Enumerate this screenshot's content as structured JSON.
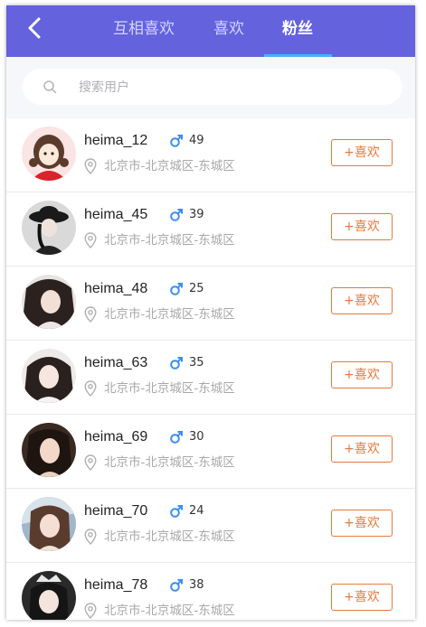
{
  "header": {
    "tabs": [
      {
        "label": "互相喜欢",
        "active": false
      },
      {
        "label": "喜欢",
        "active": false
      },
      {
        "label": "粉丝",
        "active": true
      }
    ],
    "back_icon": "chevron-left-icon",
    "background": "#6462dd",
    "active_indicator_color": "#43b4f5"
  },
  "search": {
    "placeholder": "搜索用户",
    "value": "",
    "icon": "search-icon"
  },
  "users": [
    {
      "name": "heima_12",
      "age": "49",
      "gender": "male",
      "location": "北京市-北京城区-东城区",
      "like_label": "+喜欢"
    },
    {
      "name": "heima_45",
      "age": "39",
      "gender": "male",
      "location": "北京市-北京城区-东城区",
      "like_label": "+喜欢"
    },
    {
      "name": "heima_48",
      "age": "25",
      "gender": "male",
      "location": "北京市-北京城区-东城区",
      "like_label": "+喜欢"
    },
    {
      "name": "heima_63",
      "age": "35",
      "gender": "male",
      "location": "北京市-北京城区-东城区",
      "like_label": "+喜欢"
    },
    {
      "name": "heima_69",
      "age": "30",
      "gender": "male",
      "location": "北京市-北京城区-东城区",
      "like_label": "+喜欢"
    },
    {
      "name": "heima_70",
      "age": "24",
      "gender": "male",
      "location": "北京市-北京城区-东城区",
      "like_label": "+喜欢"
    },
    {
      "name": "heima_78",
      "age": "38",
      "gender": "male",
      "location": "北京市-北京城区-东城区",
      "like_label": "+喜欢"
    }
  ],
  "colors": {
    "accent_orange": "#e47a3e",
    "gender_male": "#3b8ef0",
    "muted_text": "#a8a8a8"
  }
}
